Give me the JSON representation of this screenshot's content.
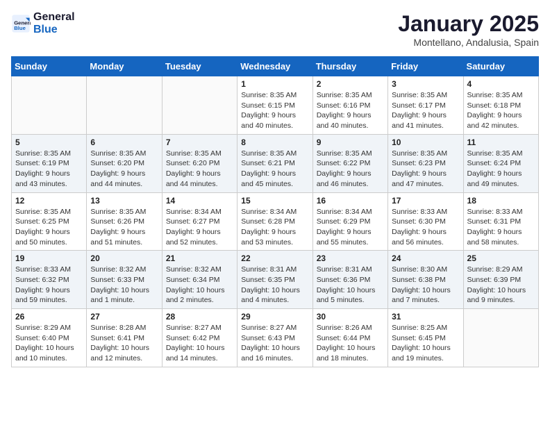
{
  "logo": {
    "line1": "General",
    "line2": "Blue"
  },
  "title": "January 2025",
  "location": "Montellano, Andalusia, Spain",
  "weekdays": [
    "Sunday",
    "Monday",
    "Tuesday",
    "Wednesday",
    "Thursday",
    "Friday",
    "Saturday"
  ],
  "weeks": [
    [
      {
        "day": "",
        "info": ""
      },
      {
        "day": "",
        "info": ""
      },
      {
        "day": "",
        "info": ""
      },
      {
        "day": "1",
        "info": "Sunrise: 8:35 AM\nSunset: 6:15 PM\nDaylight: 9 hours\nand 40 minutes."
      },
      {
        "day": "2",
        "info": "Sunrise: 8:35 AM\nSunset: 6:16 PM\nDaylight: 9 hours\nand 40 minutes."
      },
      {
        "day": "3",
        "info": "Sunrise: 8:35 AM\nSunset: 6:17 PM\nDaylight: 9 hours\nand 41 minutes."
      },
      {
        "day": "4",
        "info": "Sunrise: 8:35 AM\nSunset: 6:18 PM\nDaylight: 9 hours\nand 42 minutes."
      }
    ],
    [
      {
        "day": "5",
        "info": "Sunrise: 8:35 AM\nSunset: 6:19 PM\nDaylight: 9 hours\nand 43 minutes."
      },
      {
        "day": "6",
        "info": "Sunrise: 8:35 AM\nSunset: 6:20 PM\nDaylight: 9 hours\nand 44 minutes."
      },
      {
        "day": "7",
        "info": "Sunrise: 8:35 AM\nSunset: 6:20 PM\nDaylight: 9 hours\nand 44 minutes."
      },
      {
        "day": "8",
        "info": "Sunrise: 8:35 AM\nSunset: 6:21 PM\nDaylight: 9 hours\nand 45 minutes."
      },
      {
        "day": "9",
        "info": "Sunrise: 8:35 AM\nSunset: 6:22 PM\nDaylight: 9 hours\nand 46 minutes."
      },
      {
        "day": "10",
        "info": "Sunrise: 8:35 AM\nSunset: 6:23 PM\nDaylight: 9 hours\nand 47 minutes."
      },
      {
        "day": "11",
        "info": "Sunrise: 8:35 AM\nSunset: 6:24 PM\nDaylight: 9 hours\nand 49 minutes."
      }
    ],
    [
      {
        "day": "12",
        "info": "Sunrise: 8:35 AM\nSunset: 6:25 PM\nDaylight: 9 hours\nand 50 minutes."
      },
      {
        "day": "13",
        "info": "Sunrise: 8:35 AM\nSunset: 6:26 PM\nDaylight: 9 hours\nand 51 minutes."
      },
      {
        "day": "14",
        "info": "Sunrise: 8:34 AM\nSunset: 6:27 PM\nDaylight: 9 hours\nand 52 minutes."
      },
      {
        "day": "15",
        "info": "Sunrise: 8:34 AM\nSunset: 6:28 PM\nDaylight: 9 hours\nand 53 minutes."
      },
      {
        "day": "16",
        "info": "Sunrise: 8:34 AM\nSunset: 6:29 PM\nDaylight: 9 hours\nand 55 minutes."
      },
      {
        "day": "17",
        "info": "Sunrise: 8:33 AM\nSunset: 6:30 PM\nDaylight: 9 hours\nand 56 minutes."
      },
      {
        "day": "18",
        "info": "Sunrise: 8:33 AM\nSunset: 6:31 PM\nDaylight: 9 hours\nand 58 minutes."
      }
    ],
    [
      {
        "day": "19",
        "info": "Sunrise: 8:33 AM\nSunset: 6:32 PM\nDaylight: 9 hours\nand 59 minutes."
      },
      {
        "day": "20",
        "info": "Sunrise: 8:32 AM\nSunset: 6:33 PM\nDaylight: 10 hours\nand 1 minute."
      },
      {
        "day": "21",
        "info": "Sunrise: 8:32 AM\nSunset: 6:34 PM\nDaylight: 10 hours\nand 2 minutes."
      },
      {
        "day": "22",
        "info": "Sunrise: 8:31 AM\nSunset: 6:35 PM\nDaylight: 10 hours\nand 4 minutes."
      },
      {
        "day": "23",
        "info": "Sunrise: 8:31 AM\nSunset: 6:36 PM\nDaylight: 10 hours\nand 5 minutes."
      },
      {
        "day": "24",
        "info": "Sunrise: 8:30 AM\nSunset: 6:38 PM\nDaylight: 10 hours\nand 7 minutes."
      },
      {
        "day": "25",
        "info": "Sunrise: 8:29 AM\nSunset: 6:39 PM\nDaylight: 10 hours\nand 9 minutes."
      }
    ],
    [
      {
        "day": "26",
        "info": "Sunrise: 8:29 AM\nSunset: 6:40 PM\nDaylight: 10 hours\nand 10 minutes."
      },
      {
        "day": "27",
        "info": "Sunrise: 8:28 AM\nSunset: 6:41 PM\nDaylight: 10 hours\nand 12 minutes."
      },
      {
        "day": "28",
        "info": "Sunrise: 8:27 AM\nSunset: 6:42 PM\nDaylight: 10 hours\nand 14 minutes."
      },
      {
        "day": "29",
        "info": "Sunrise: 8:27 AM\nSunset: 6:43 PM\nDaylight: 10 hours\nand 16 minutes."
      },
      {
        "day": "30",
        "info": "Sunrise: 8:26 AM\nSunset: 6:44 PM\nDaylight: 10 hours\nand 18 minutes."
      },
      {
        "day": "31",
        "info": "Sunrise: 8:25 AM\nSunset: 6:45 PM\nDaylight: 10 hours\nand 19 minutes."
      },
      {
        "day": "",
        "info": ""
      }
    ]
  ]
}
